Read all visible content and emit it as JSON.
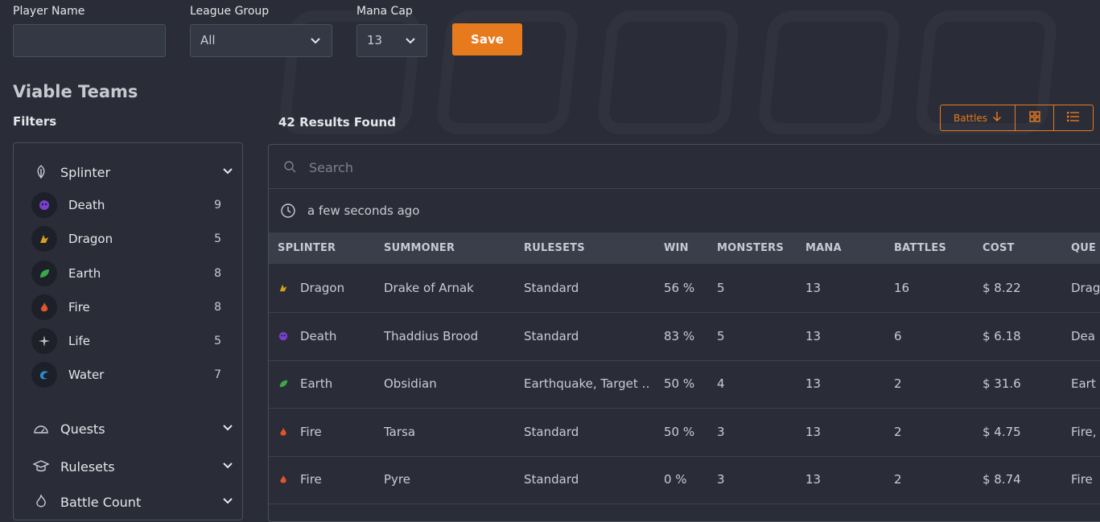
{
  "form": {
    "player_name_label": "Player Name",
    "player_name_value": "",
    "league_group_label": "League Group",
    "league_group_value": "All",
    "mana_cap_label": "Mana Cap",
    "mana_cap_value": "13",
    "save_label": "Save"
  },
  "page_title": "Viable Teams",
  "filters_title": "Filters",
  "results_text": "42 Results Found",
  "toolbar": {
    "sort_label": "Battles",
    "sort_icon": "arrow-down-icon",
    "grid_icon": "grid-icon",
    "list_icon": "list-icon",
    "accent": "#e87a1e"
  },
  "filter_panel": {
    "splinter_section": "Splinter",
    "splinters": [
      {
        "name": "Death",
        "count": "9",
        "color": "#7b3fd1"
      },
      {
        "name": "Dragon",
        "count": "5",
        "color": "#d6a11c"
      },
      {
        "name": "Earth",
        "count": "8",
        "color": "#3aa84a"
      },
      {
        "name": "Fire",
        "count": "8",
        "color": "#e0562a"
      },
      {
        "name": "Life",
        "count": "5",
        "color": "#d9d9d9"
      },
      {
        "name": "Water",
        "count": "7",
        "color": "#2a8fd0"
      }
    ],
    "quests_section": "Quests",
    "rulesets_section": "Rulesets",
    "battle_count_section": "Battle Count"
  },
  "table": {
    "search_placeholder": "Search",
    "updated_text": "a few seconds ago",
    "columns": [
      "SPLINTER",
      "SUMMONER",
      "RULESETS",
      "WIN",
      "MONSTERS",
      "MANA",
      "BATTLES",
      "COST",
      "QUE"
    ],
    "rows": [
      {
        "splinter": "Dragon",
        "summoner": "Drake of Arnak",
        "rulesets": "Standard",
        "win": "56 %",
        "monsters": "5",
        "mana": "13",
        "battles": "16",
        "cost": "$ 8.22",
        "quest": "Drag"
      },
      {
        "splinter": "Death",
        "summoner": "Thaddius Brood",
        "rulesets": "Standard",
        "win": "83 %",
        "monsters": "5",
        "mana": "13",
        "battles": "6",
        "cost": "$ 6.18",
        "quest": "Dea"
      },
      {
        "splinter": "Earth",
        "summoner": "Obsidian",
        "rulesets": "Earthquake, Target …",
        "win": "50 %",
        "monsters": "4",
        "mana": "13",
        "battles": "2",
        "cost": "$ 31.6",
        "quest": "Eart"
      },
      {
        "splinter": "Fire",
        "summoner": "Tarsa",
        "rulesets": "Standard",
        "win": "50 %",
        "monsters": "3",
        "mana": "13",
        "battles": "2",
        "cost": "$ 4.75",
        "quest": "Fire,"
      },
      {
        "splinter": "Fire",
        "summoner": "Pyre",
        "rulesets": "Standard",
        "win": "0 %",
        "monsters": "3",
        "mana": "13",
        "battles": "2",
        "cost": "$ 8.74",
        "quest": "Fire"
      }
    ]
  }
}
